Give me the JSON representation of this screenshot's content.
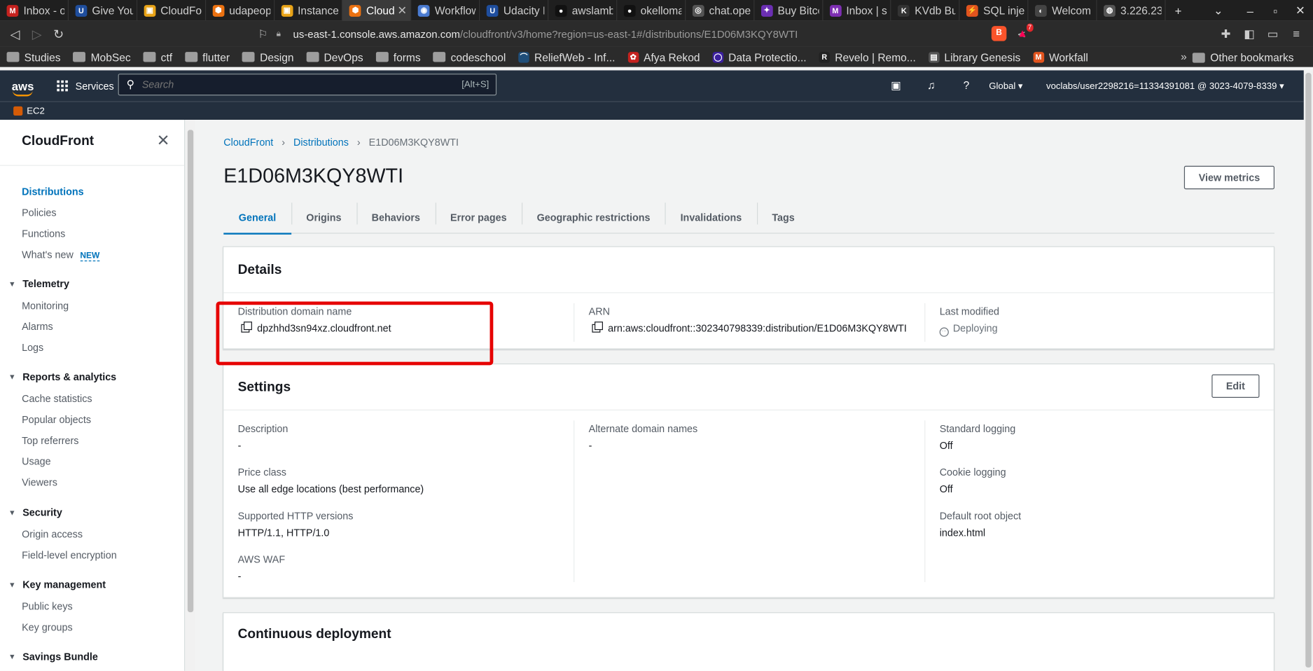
{
  "browser": {
    "tabs": [
      {
        "title": "Inbox - o",
        "fav_color": "#c5221f",
        "fav_glyph": "M"
      },
      {
        "title": "Give Your",
        "fav_color": "#1f4e9e",
        "fav_glyph": "U"
      },
      {
        "title": "CloudFor",
        "fav_color": "#e8a317",
        "fav_glyph": "▣"
      },
      {
        "title": "udapeop",
        "fav_color": "#ec7211",
        "fav_glyph": "⬢"
      },
      {
        "title": "Instance",
        "fav_color": "#e8a317",
        "fav_glyph": "▣"
      },
      {
        "title": "Cloud",
        "fav_color": "#ec7211",
        "fav_glyph": "⬢",
        "active": true
      },
      {
        "title": "Workflow",
        "fav_color": "#4a7bd1",
        "fav_glyph": "◉"
      },
      {
        "title": "Udacity F",
        "fav_color": "#1f4e9e",
        "fav_glyph": "U"
      },
      {
        "title": "awslamb",
        "fav_color": "#111111",
        "fav_glyph": "●"
      },
      {
        "title": "okelloma",
        "fav_color": "#111111",
        "fav_glyph": "●"
      },
      {
        "title": "chat.ope",
        "fav_color": "#555555",
        "fav_glyph": "◎"
      },
      {
        "title": "Buy Bitco",
        "fav_color": "#6b2fb3",
        "fav_glyph": "✦"
      },
      {
        "title": "Inbox | sa",
        "fav_color": "#7e2fb3",
        "fav_glyph": "M"
      },
      {
        "title": "KVdb Bu",
        "fav_color": "#333333",
        "fav_glyph": "K"
      },
      {
        "title": "SQL injec",
        "fav_color": "#e2541e",
        "fav_glyph": "⚡"
      },
      {
        "title": "Welcom",
        "fav_color": "#444444",
        "fav_glyph": "◐"
      },
      {
        "title": "3.226.23",
        "fav_color": "#555555",
        "fav_glyph": "◍"
      }
    ],
    "url_host": "us-east-1.console.aws.amazon.com",
    "url_path": "/cloudfront/v3/home?region=us-east-1#/distributions/E1D06M3KQY8WTI",
    "rewards_count": "7",
    "bookmarks": [
      {
        "label": "Studies",
        "type": "folder"
      },
      {
        "label": "MobSec",
        "type": "folder"
      },
      {
        "label": "ctf",
        "type": "folder"
      },
      {
        "label": "flutter",
        "type": "folder"
      },
      {
        "label": "Design",
        "type": "folder"
      },
      {
        "label": "DevOps",
        "type": "folder"
      },
      {
        "label": "forms",
        "type": "folder"
      },
      {
        "label": "codeschool",
        "type": "folder"
      },
      {
        "label": "ReliefWeb - Inf...",
        "type": "site",
        "color": "#1f4e79",
        "glyph": "⌒"
      },
      {
        "label": "Afya Rekod",
        "type": "site",
        "color": "#c5221f",
        "glyph": "✿"
      },
      {
        "label": "Data Protectio...",
        "type": "site",
        "color": "#3b1f9e",
        "glyph": "◯"
      },
      {
        "label": "Revelo | Remo...",
        "type": "site",
        "color": "#222222",
        "glyph": "R"
      },
      {
        "label": "Library Genesis",
        "type": "site",
        "color": "#555555",
        "glyph": "▤"
      },
      {
        "label": "Workfall",
        "type": "site",
        "color": "#e2541e",
        "glyph": "M"
      }
    ],
    "other_bookmarks": "Other bookmarks"
  },
  "aws_header": {
    "logo": "aws",
    "services": "Services",
    "search_placeholder": "Search",
    "search_shortcut": "[Alt+S]",
    "region": "Global",
    "account": "voclabs/user2298216=11334391081 @ 3023-4079-8339",
    "favorite": "EC2"
  },
  "sidebar": {
    "title": "CloudFront",
    "items": [
      {
        "label": "Distributions",
        "active": true
      },
      {
        "label": "Policies"
      },
      {
        "label": "Functions"
      },
      {
        "label": "What's new",
        "badge": "NEW"
      }
    ],
    "sections": [
      {
        "title": "Telemetry",
        "items": [
          "Monitoring",
          "Alarms",
          "Logs"
        ]
      },
      {
        "title": "Reports & analytics",
        "items": [
          "Cache statistics",
          "Popular objects",
          "Top referrers",
          "Usage",
          "Viewers"
        ]
      },
      {
        "title": "Security",
        "items": [
          "Origin access",
          "Field-level encryption"
        ]
      },
      {
        "title": "Key management",
        "items": [
          "Public keys",
          "Key groups"
        ]
      },
      {
        "title": "Savings Bundle",
        "items": []
      }
    ]
  },
  "breadcrumb": {
    "root": "CloudFront",
    "section": "Distributions",
    "current": "E1D06M3KQY8WTI"
  },
  "page": {
    "title": "E1D06M3KQY8WTI",
    "view_metrics": "View metrics",
    "tabs": [
      "General",
      "Origins",
      "Behaviors",
      "Error pages",
      "Geographic restrictions",
      "Invalidations",
      "Tags"
    ],
    "active_tab": "General"
  },
  "details": {
    "heading": "Details",
    "domain_label": "Distribution domain name",
    "domain_value": "dpzhhd3sn94xz.cloudfront.net",
    "arn_label": "ARN",
    "arn_value": "arn:aws:cloudfront::302340798339:distribution/E1D06M3KQY8WTI",
    "modified_label": "Last modified",
    "modified_value": "Deploying"
  },
  "settings": {
    "heading": "Settings",
    "edit": "Edit",
    "description_label": "Description",
    "description_value": "-",
    "price_label": "Price class",
    "price_value": "Use all edge locations (best performance)",
    "http_label": "Supported HTTP versions",
    "http_value": "HTTP/1.1, HTTP/1.0",
    "waf_label": "AWS WAF",
    "waf_value": "-",
    "alt_label": "Alternate domain names",
    "alt_value": "-",
    "stdlog_label": "Standard logging",
    "stdlog_value": "Off",
    "cookie_label": "Cookie logging",
    "cookie_value": "Off",
    "root_label": "Default root object",
    "root_value": "index.html"
  },
  "continuous": {
    "heading": "Continuous deployment"
  },
  "colors": {
    "aws_nav": "#232f3e",
    "link": "#0073bb",
    "highlight": "#e60000",
    "aws_orange": "#ff9900"
  }
}
